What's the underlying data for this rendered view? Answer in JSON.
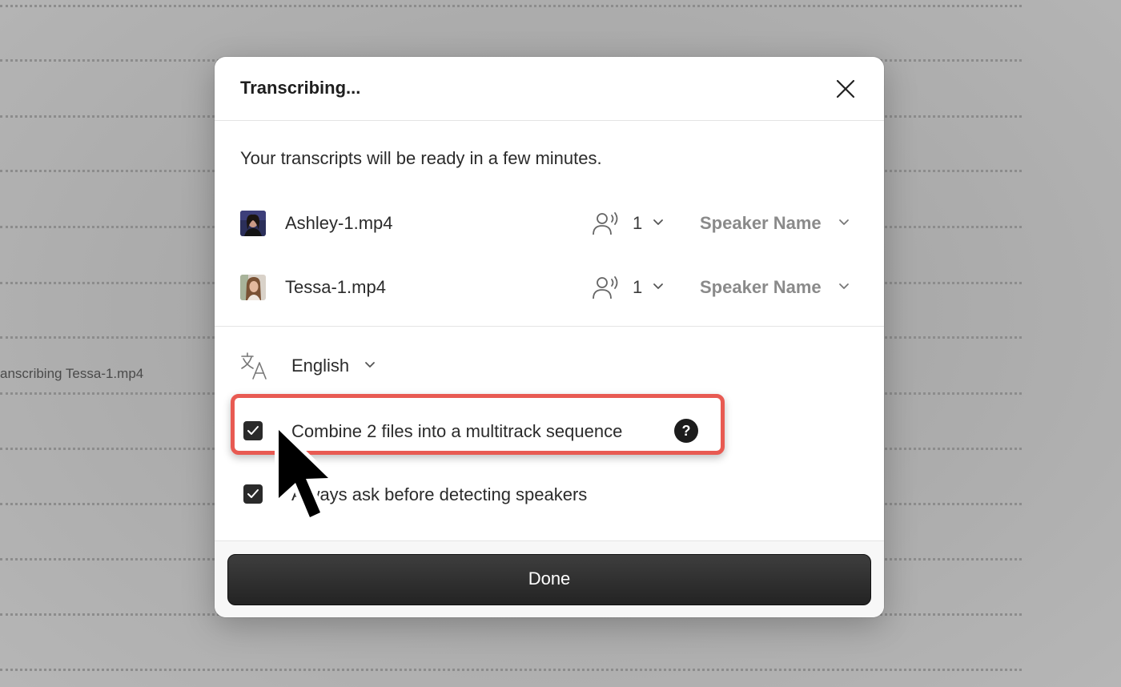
{
  "background": {
    "text": "anscribing Tessa-1.mp4"
  },
  "dialog": {
    "title": "Transcribing...",
    "subtitle": "Your transcripts will be ready in a few minutes.",
    "files": [
      {
        "name": "Ashley-1.mp4",
        "speaker_count": "1",
        "speaker_name": "Speaker Name"
      },
      {
        "name": "Tessa-1.mp4",
        "speaker_count": "1",
        "speaker_name": "Speaker Name"
      }
    ],
    "language": "English",
    "options": [
      {
        "label": "Combine 2 files into a multitrack sequence",
        "checked": true,
        "help": "?"
      },
      {
        "label": "Always ask before detecting speakers",
        "checked": true
      }
    ],
    "done_label": "Done"
  },
  "colors": {
    "highlight": "#e85a52",
    "button": "#2a2a2a"
  },
  "icons": {
    "close": "close-icon",
    "speakers": "people-speaking-icon",
    "chevron": "chevron-down-icon",
    "language": "translate-icon",
    "help": "question-mark-icon",
    "check": "checkmark-icon",
    "cursor": "mouse-pointer-icon"
  }
}
